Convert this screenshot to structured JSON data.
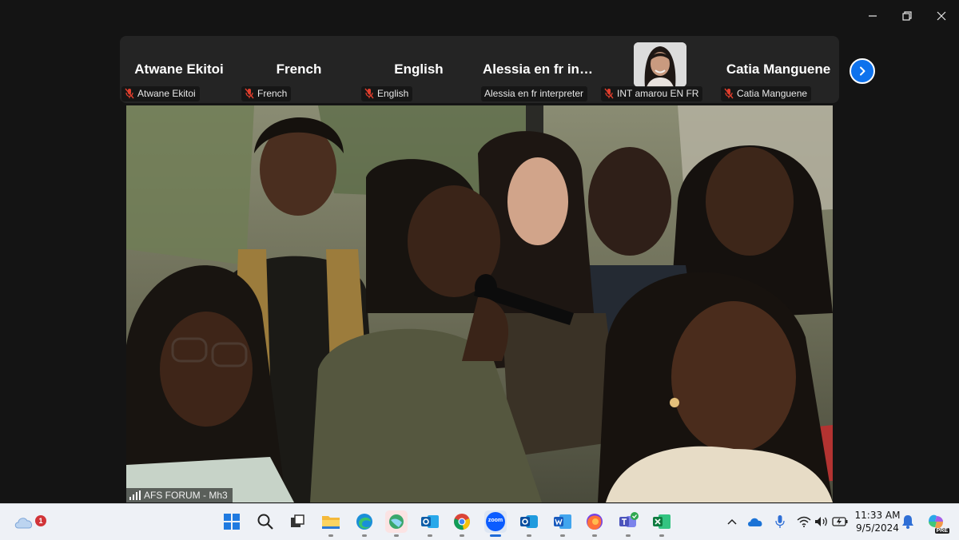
{
  "window": {
    "controls": [
      "minimize",
      "restore",
      "close"
    ]
  },
  "participants": [
    {
      "tile_name": "Atwane Ekitoi",
      "label": "Atwane Ekitoi",
      "muted": true
    },
    {
      "tile_name": "French",
      "label": "French",
      "muted": true
    },
    {
      "tile_name": "English",
      "label": "English",
      "muted": true
    },
    {
      "tile_name": "Alessia en fr int...",
      "label": "Alessia en fr interpreter",
      "muted": false
    },
    {
      "tile_name": "",
      "label": "INT amarou EN FR",
      "muted": true,
      "has_video": true
    },
    {
      "tile_name": "Catia Manguene",
      "label": "Catia Manguene",
      "muted": true
    }
  ],
  "strip": {
    "next_icon": "chevron-right-icon"
  },
  "main_video": {
    "label": "AFS FORUM - Mh3",
    "signal_icon": "signal-bars-icon"
  },
  "taskbar": {
    "weather_badge": "1",
    "apps": [
      "windows-start-icon",
      "search-icon",
      "task-view-icon",
      "file-explorer-icon",
      "edge-icon",
      "maps-icon",
      "outlook-icon",
      "chrome-icon",
      "zoom-icon",
      "outlook-new-icon",
      "word-icon",
      "firefox-icon",
      "teams-icon",
      "excel-icon"
    ],
    "zoom_label": "zoom",
    "clock_time": "11:33 AM",
    "clock_date": "9/5/2024",
    "copilot_badge": "PRE"
  },
  "colors": {
    "accent": "#0e72ed",
    "muted_red": "#e03e2d",
    "taskbar_bg": "#eef1f6"
  }
}
